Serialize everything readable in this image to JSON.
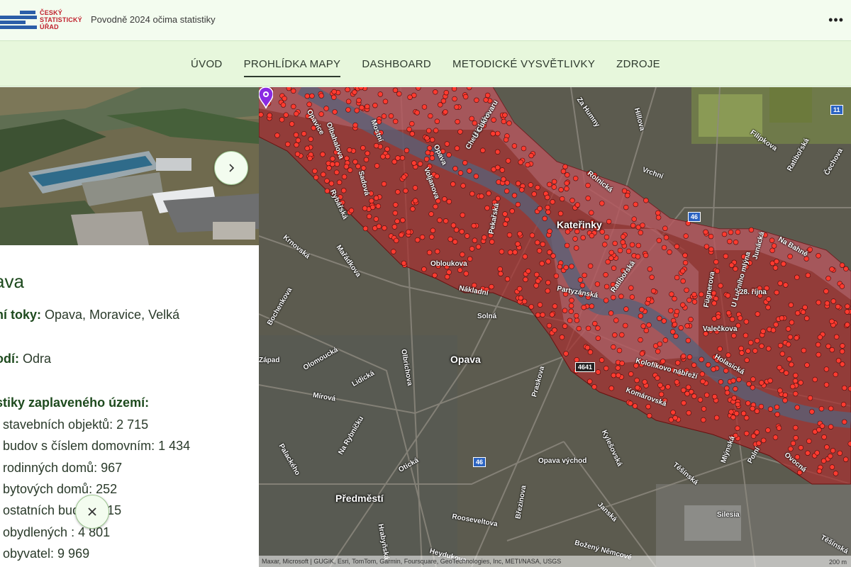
{
  "header": {
    "logo": {
      "line1": "ČESKÝ",
      "line2": "STATISTICKÝ",
      "line3": "ÚŘAD"
    },
    "title": "Povodně 2024 očima statistiky",
    "more_label": "•••"
  },
  "nav": {
    "tabs": [
      {
        "label": "ÚVOD",
        "active": false
      },
      {
        "label": "PROHLÍDKA MAPY",
        "active": true
      },
      {
        "label": "DASHBOARD",
        "active": false
      },
      {
        "label": "METODICKÉ VYSVĚTLIVKY",
        "active": false
      },
      {
        "label": "ZDROJE",
        "active": false
      }
    ]
  },
  "panel": {
    "place": "ava",
    "rivers_label": "ní toky:",
    "rivers_value": " Opava, Moravice, Velká",
    "basin_label": "odí:",
    "basin_value": " Odra",
    "stats_heading": "stiky zaplaveného území:",
    "stats": [
      "t stavebních objektů: 2 715",
      "t budov s číslem domovním: 1 434",
      "t rodinných domů: 967",
      "t bytových domů: 252",
      "t ostatních budov: 215",
      "t obydlených      : 4 801",
      "t obyvatel: 9 969"
    ],
    "next_icon": "chevron-right-icon",
    "close_icon": "close-icon"
  },
  "map": {
    "districts": [
      "Kateřinky",
      "Opava",
      "Předměstí"
    ],
    "streets": [
      "Opavice",
      "Olbahalova",
      "Mostní",
      "Chelčického",
      "U Cukrovaru",
      "Opava",
      "Za Humny",
      "Hillova",
      "Filipkova",
      "Ratibořská",
      "Čechova",
      "Rolnická",
      "Vrchní",
      "Rybářská",
      "Sadová",
      "Voljanova",
      "Pekařská",
      "Krnovská",
      "Mařádkova",
      "Obloukova",
      "Nákladní",
      "Partyzánská",
      "Ratibořská",
      "Na Bahně",
      "Junácká",
      "28. října",
      "Fügnerova",
      "U Lučního mlýna",
      "Valečkova",
      "Solná",
      "Bochenkova",
      "Olomoucká",
      "Lidická",
      "Olbrichova",
      "Mírová",
      "Kolofíkovo nábřeží",
      "Holasická",
      "Komárovská",
      "Praskova",
      "Na Rybníčku",
      "Palackého",
      "Otická",
      "Kylešovská",
      "Opava východ",
      "Těšínská",
      "Mlýnská",
      "Polní",
      "Ovocná",
      "Březinova",
      "Janská",
      "Rooseveltova",
      "Hrabyňská",
      "Božený Němcové",
      "Heydukova",
      "Silesia",
      "Těšínská",
      "Západ"
    ],
    "shields": [
      "11",
      "46",
      "4641",
      "46"
    ],
    "attribution": "Maxar, Microsoft | GUGiK, Esri, TomTom, Garmin, Foursquare, GeoTechnologies, Inc, METI/NASA, USGS",
    "scale": "200 m",
    "flood_color": "#a83030",
    "point_color": "#ff3b30"
  }
}
